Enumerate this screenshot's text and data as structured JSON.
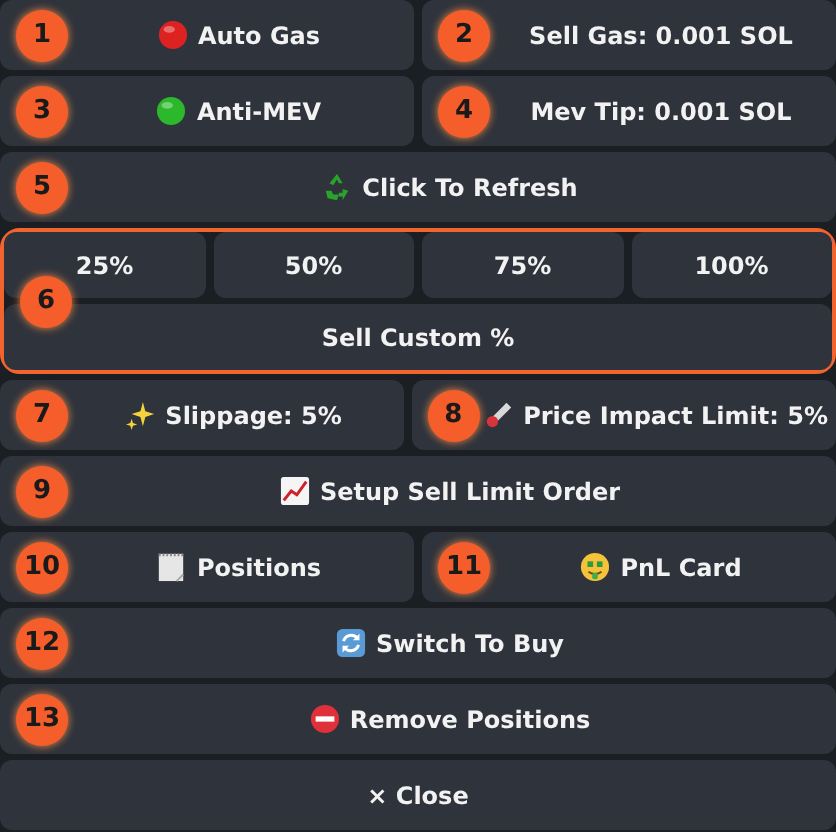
{
  "sections": [
    {
      "kind": "row",
      "buttons": [
        {
          "label": "Auto Gas",
          "badge": "1",
          "on": false
        },
        {
          "label": "Sell Gas: 0.001 SOL",
          "badge": "2"
        }
      ]
    },
    {
      "kind": "row",
      "buttons": [
        {
          "label": "Anti-MEV",
          "badge": "3",
          "on": true
        },
        {
          "label": "Mev Tip: 0.001 SOL",
          "badge": "4"
        }
      ]
    },
    {
      "kind": "row",
      "buttons": [
        {
          "label": "Click To Refresh",
          "badge": "5"
        }
      ]
    },
    {
      "kind": "group",
      "badge": "6",
      "rows": [
        {
          "buttons": [
            {
              "label": "25%"
            },
            {
              "label": "50%"
            },
            {
              "label": "75%"
            },
            {
              "label": "100%"
            }
          ]
        },
        {
          "buttons": [
            {
              "label": "Sell Custom %"
            }
          ]
        }
      ]
    },
    {
      "kind": "row",
      "buttons": [
        {
          "label": "Slippage: 5%",
          "badge": "7"
        },
        {
          "label": "Price Impact Limit: 5%",
          "badge": "8"
        }
      ]
    },
    {
      "kind": "row",
      "buttons": [
        {
          "label": "Setup Sell Limit Order",
          "badge": "9"
        }
      ]
    },
    {
      "kind": "row",
      "buttons": [
        {
          "label": "Positions",
          "badge": "10"
        },
        {
          "label": "PnL Card",
          "badge": "11"
        }
      ]
    },
    {
      "kind": "row",
      "buttons": [
        {
          "label": "Switch To Buy",
          "badge": "12"
        }
      ]
    },
    {
      "kind": "row",
      "buttons": [
        {
          "label": "Remove Positions",
          "badge": "13"
        }
      ]
    },
    {
      "kind": "row",
      "buttons": [
        {
          "label": "× Close"
        }
      ]
    }
  ]
}
